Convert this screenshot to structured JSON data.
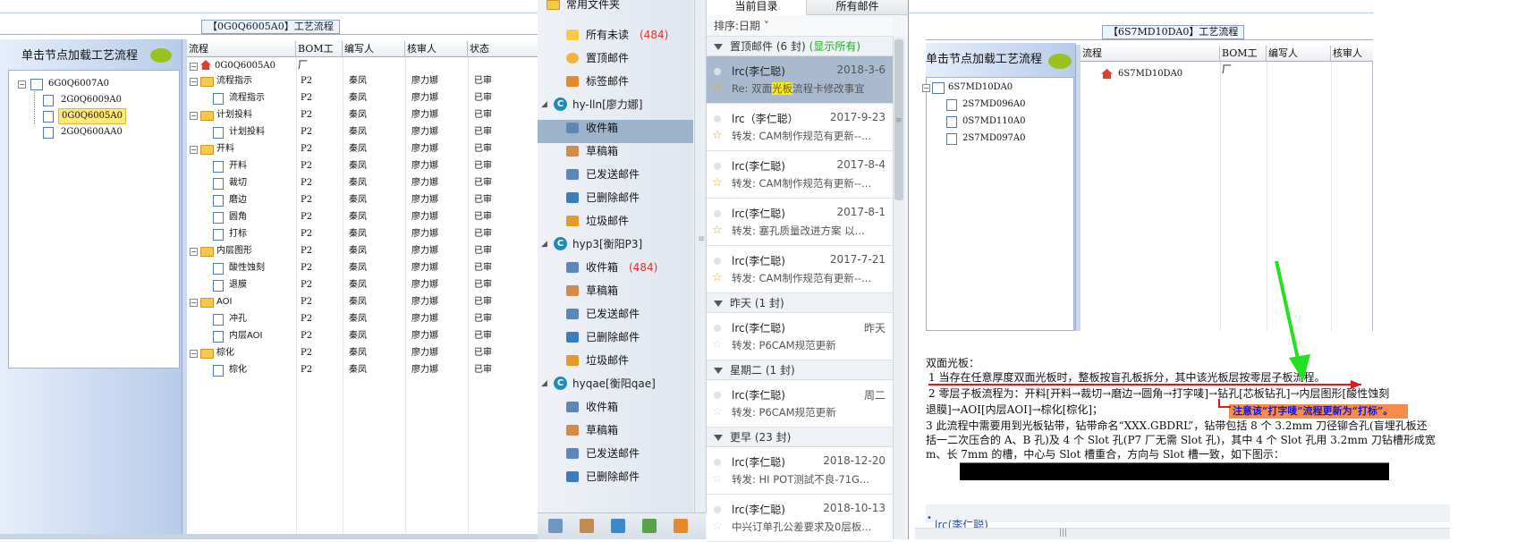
{
  "left_panel": {
    "title": "【0G0Q6005A0】工艺流程",
    "load_label": "单击节点加载工艺流程",
    "tree": [
      {
        "label": "6G0Q6007A0"
      },
      {
        "label": "2G0Q6009A0"
      },
      {
        "label": "0G0Q6005A0"
      },
      {
        "label": "2G0Q600AA0"
      }
    ],
    "grid_headers": [
      "流程",
      "BOM工厂",
      "编写人",
      "核审人",
      "状态"
    ],
    "grid_root": "0G0Q6005A0",
    "rows": [
      {
        "name": "流程指示",
        "folder": true
      },
      {
        "name": "流程指示",
        "folder": false
      },
      {
        "name": "计划投料",
        "folder": true
      },
      {
        "name": "计划投料",
        "folder": false
      },
      {
        "name": "开料",
        "folder": true
      },
      {
        "name": "开料",
        "folder": false
      },
      {
        "name": "裁切",
        "folder": false
      },
      {
        "name": "磨边",
        "folder": false
      },
      {
        "name": "圆角",
        "folder": false
      },
      {
        "name": "打标",
        "folder": false
      },
      {
        "name": "内层图形",
        "folder": true
      },
      {
        "name": "酸性蚀刻",
        "folder": false
      },
      {
        "name": "退膜",
        "folder": false
      },
      {
        "name": "AOI",
        "folder": true
      },
      {
        "name": "冲孔",
        "folder": false
      },
      {
        "name": "内层AOI",
        "folder": false
      },
      {
        "name": "棕化",
        "folder": true
      },
      {
        "name": "棕化",
        "folder": false
      }
    ],
    "row_factory": "P2",
    "row_writer": "秦凤",
    "row_reviewer": "廖力娜",
    "row_status": "已审"
  },
  "mail": {
    "common_folder": "常用文件夹",
    "folder_items": [
      {
        "label": "所有未读",
        "count": "(484)"
      },
      {
        "label": "置顶邮件",
        "count": ""
      },
      {
        "label": "标签邮件",
        "count": ""
      }
    ],
    "accounts": [
      {
        "name": "hy-lln[廖力娜]",
        "items": [
          {
            "label": "收件箱",
            "count": ""
          },
          {
            "label": "草稿箱",
            "count": ""
          },
          {
            "label": "已发送邮件",
            "count": ""
          },
          {
            "label": "已删除邮件",
            "count": ""
          },
          {
            "label": "垃圾邮件",
            "count": ""
          }
        ]
      },
      {
        "name": "hyp3[衡阳P3]",
        "items": [
          {
            "label": "收件箱",
            "count": "(484)"
          },
          {
            "label": "草稿箱",
            "count": ""
          },
          {
            "label": "已发送邮件",
            "count": ""
          },
          {
            "label": "已删除邮件",
            "count": ""
          },
          {
            "label": "垃圾邮件",
            "count": ""
          }
        ]
      },
      {
        "name": "hyqae[衡阳qae]",
        "items": [
          {
            "label": "收件箱",
            "count": ""
          },
          {
            "label": "草稿箱",
            "count": ""
          },
          {
            "label": "已发送邮件",
            "count": ""
          },
          {
            "label": "已删除邮件",
            "count": ""
          }
        ]
      }
    ],
    "tabs": [
      "当前目录",
      "所有邮件"
    ],
    "sort_label": "排序:日期",
    "groups": {
      "pinned": {
        "label": "置顶邮件 (6 封)",
        "extra": "(显示所有)"
      },
      "yesterday": {
        "label": "昨天 (1 封)"
      },
      "tuesday": {
        "label": "星期二 (1 封)"
      },
      "older": {
        "label": "更早 (23 封)"
      }
    },
    "messages": [
      {
        "from": "lrc(李仁聪)",
        "date": "2018-3-6",
        "subj_pre": "Re: 双面",
        "subj_hl": "光板",
        "subj_post": "流程卡修改事宜"
      },
      {
        "from": "lrc（李仁聪）",
        "date": "2017-9-23",
        "subj": "转发: CAM制作规范有更新--..."
      },
      {
        "from": "lrc(李仁聪)",
        "date": "2017-8-4",
        "subj": "转发: CAM制作规范有更新--..."
      },
      {
        "from": "lrc(李仁聪)",
        "date": "2017-8-1",
        "subj": "转发: 塞孔质量改进方案 以..."
      },
      {
        "from": "lrc(李仁聪)",
        "date": "2017-7-21",
        "subj": "转发: CAM制作规范有更新--..."
      },
      {
        "from": "lrc(李仁聪)",
        "date": "昨天",
        "subj": "转发: P6CAM规范更新"
      },
      {
        "from": "lrc(李仁聪)",
        "date": "周二",
        "subj": "转发: P6CAM规范更新"
      },
      {
        "from": "lrc(李仁聪)",
        "date": "2018-12-20",
        "subj": "转发: HI POT测試不良-71G..."
      },
      {
        "from": "lrc(李仁聪)",
        "date": "2018-10-13",
        "subj": "中兴订单孔公差要求及0层板..."
      }
    ]
  },
  "right_panel": {
    "title": "【6S7MD10DA0】工艺流程",
    "load_label": "单击节点加载工艺流程",
    "tree": [
      "6S7MD10DA0",
      "2S7MD096A0",
      "0S7MD110A0",
      "2S7MD097A0"
    ],
    "grid_headers": [
      "流程",
      "BOM工厂",
      "编写人",
      "核审人"
    ],
    "grid_root": "6S7MD10DA0",
    "doc_lines": [
      "双面光板：",
      "1 当存在任意厚度双面光板时，整板按盲孔板拆分，其中该光板层按零层子板流程。",
      "2 零层子板流程为：开料[开料→裁切→磨边→圆角→打字唛]→钻孔[芯板钻孔]→内层图形[酸性蚀刻",
      "退膜]→AOI[内层AOI]→棕化[棕化]；",
      "3 此流程中需要用到光板钻带，钻带命名“XXX.GBDRL”，钻带包括 8 个 3.2mm 刀径铆合孔(盲埋孔板还",
      "括一二次压合的 A、B 孔)及 4 个 Slot 孔(P7 厂无需 Slot 孔)，其中 4 个 Slot 孔用 3.2mm 刀钻槽形成宽",
      "m、长 7mm 的槽，中心与 Slot 槽重合，方向与 Slot 槽一致，如下图示："
    ],
    "note": "注意该“打字唛”流程更新为“打标”。",
    "link": "lrc(李仁聪)"
  }
}
